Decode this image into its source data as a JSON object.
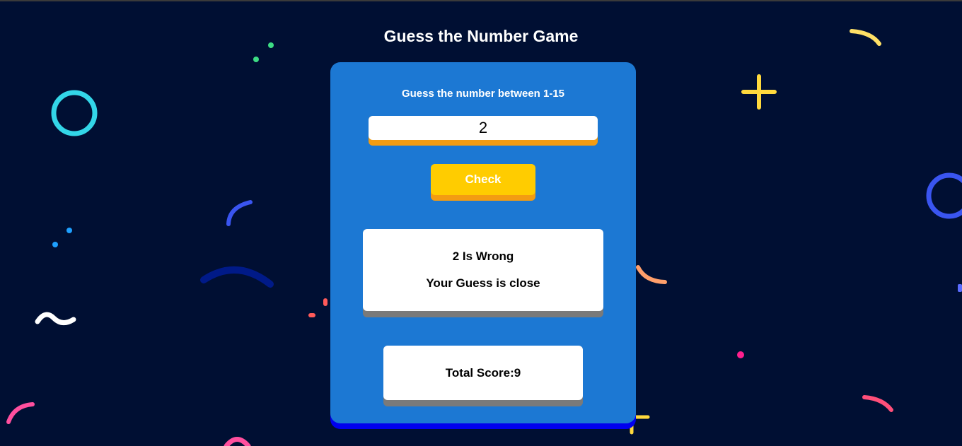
{
  "game": {
    "title": "Guess the Number Game",
    "prompt": "Guess the number between 1-15",
    "guess_value": "2",
    "check_label": "Check",
    "result_line": "2 Is Wrong",
    "hint_line": "Your Guess is close",
    "score_text": "Total Score:9"
  },
  "colors": {
    "background": "#000f33",
    "card": "#1c78d3",
    "card_shadow": "#0000ee",
    "check_button": "#ffcc00",
    "accent_shadow": "#f39c12"
  }
}
